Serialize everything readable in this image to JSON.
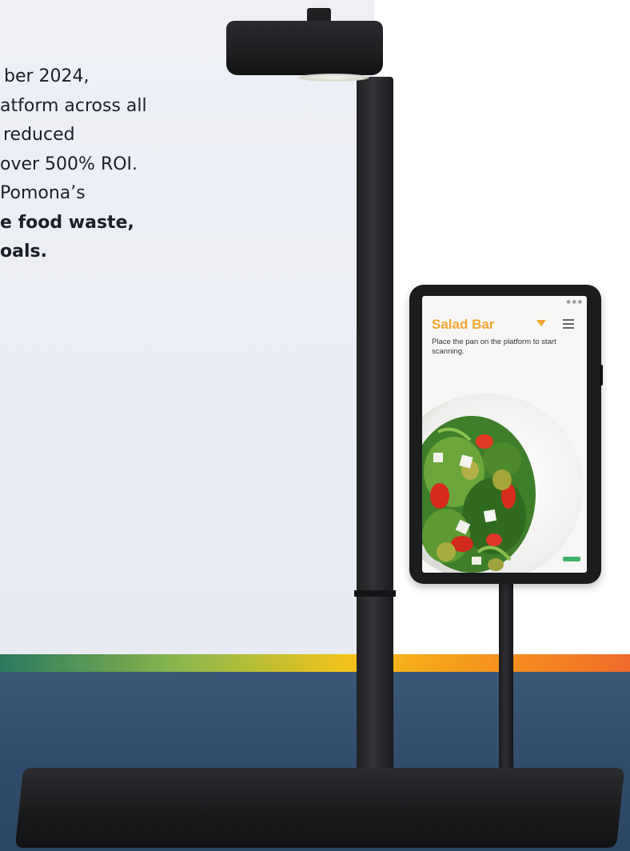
{
  "body_text": {
    "lines": [
      "ber 2024,",
      "atform across all",
      "reduced",
      "over 500% ROI.",
      "Pomona’s"
    ],
    "bold_lines": [
      "e food waste,",
      "oals."
    ]
  },
  "tablet_screen": {
    "title": "Salad Bar",
    "instructions": "Place the pan on the platform to start scanning.",
    "accent_color": "#f2a532",
    "button_color": "#3fb36b",
    "icons": [
      "chevron-down-icon",
      "hamburger-menu-icon"
    ]
  }
}
